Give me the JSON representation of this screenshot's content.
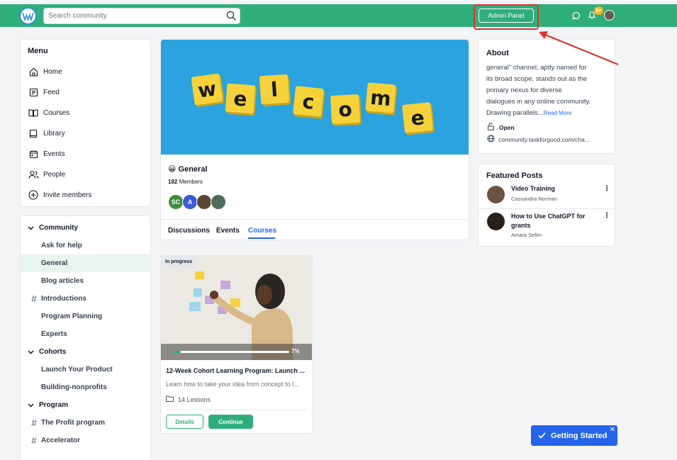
{
  "topbar": {
    "search_placeholder": "Search community",
    "admin_button": "Admin Panel",
    "notification_count": "9+"
  },
  "menu": {
    "title": "Menu",
    "items": [
      {
        "label": "Home",
        "icon": "home-icon"
      },
      {
        "label": "Feed",
        "icon": "feed-icon"
      },
      {
        "label": "Courses",
        "icon": "book-open-icon"
      },
      {
        "label": "Library",
        "icon": "library-icon"
      },
      {
        "label": "Events",
        "icon": "calendar-icon"
      },
      {
        "label": "People",
        "icon": "people-icon"
      },
      {
        "label": "Invite members",
        "icon": "plus-circle-icon"
      }
    ]
  },
  "nav": {
    "community": {
      "label": "Community",
      "items": [
        "Ask for help",
        "General",
        "Blog articles",
        "Introductions",
        "Program Planning",
        "Experts"
      ]
    },
    "cohorts": {
      "label": "Cohorts",
      "items": [
        "Launch Your Product",
        "Building-nonprofits"
      ]
    },
    "program": {
      "label": "Program",
      "items": [
        "The Profit program",
        "Accelerator"
      ]
    }
  },
  "channel": {
    "banner_letters": [
      "w",
      "e",
      "l",
      "c",
      "o",
      "m",
      "e"
    ],
    "emoji": "😀",
    "name": "General",
    "member_count": "182",
    "members_label": "Members",
    "avatars": [
      {
        "initials": "SC",
        "color": "#3d8b3d"
      },
      {
        "initials": "A",
        "color": "#3b5bdb"
      },
      {
        "initials": "",
        "color": "#5b4636"
      },
      {
        "initials": "",
        "color": "#4f6b5a"
      }
    ],
    "tabs": [
      "Discussions",
      "Events",
      "Courses"
    ],
    "active_tab": "Courses"
  },
  "course": {
    "status": "In progress",
    "progress_percent": 7,
    "progress_label": "7%",
    "title": "12-Week Cohort Learning Program: Launch ...",
    "description": "Learn how to take your idea from concept to l...",
    "lessons": "14 Lessons",
    "details_button": "Details",
    "continue_button": "Continue"
  },
  "about": {
    "title": "About",
    "text_lines": [
      "general\" channel, aptly named for",
      "its broad scope, stands out as the",
      "primary nexus for diverse",
      "dialogues in any online community.",
      "Drawing parallels..."
    ],
    "read_more": "Read More",
    "privacy": "Open",
    "url": "community.taskforgood.com/cha..."
  },
  "featured": {
    "title": "Featured Posts",
    "posts": [
      {
        "title": "Video Training",
        "author": "Cassandra Norman"
      },
      {
        "title": "How to Use ChatGPT for grants",
        "author": "Amara Selim"
      }
    ]
  },
  "getting_started": "Getting Started",
  "colors": {
    "brand": "#2fae7b",
    "accent": "#2563eb",
    "highlight": "#d9362f"
  }
}
